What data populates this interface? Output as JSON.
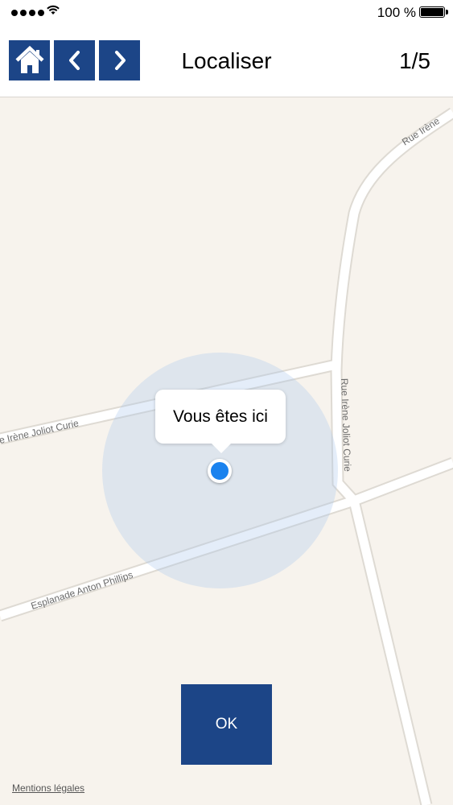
{
  "status_bar": {
    "battery_text": "100 %"
  },
  "header": {
    "title": "Localiser",
    "step": "1/5"
  },
  "map": {
    "streets": {
      "rue_irene_top": "Rue Irène",
      "rue_irene_west": "e Irène Joliot Curie",
      "rue_irene_vertical": "Rue Irène Joliot Curie",
      "esplanade": "Esplanade Anton Phillips"
    },
    "callout_text": "Vous êtes ici"
  },
  "actions": {
    "ok_label": "OK"
  },
  "footer": {
    "legal_link": "Mentions légales"
  },
  "colors": {
    "brand": "#1c4587",
    "location_dot": "#1a82ee",
    "map_background": "#f7f3ed",
    "road": "#ffffff"
  },
  "icons": {
    "home": "home-icon",
    "back": "chevron-left-icon",
    "forward": "chevron-right-icon"
  }
}
